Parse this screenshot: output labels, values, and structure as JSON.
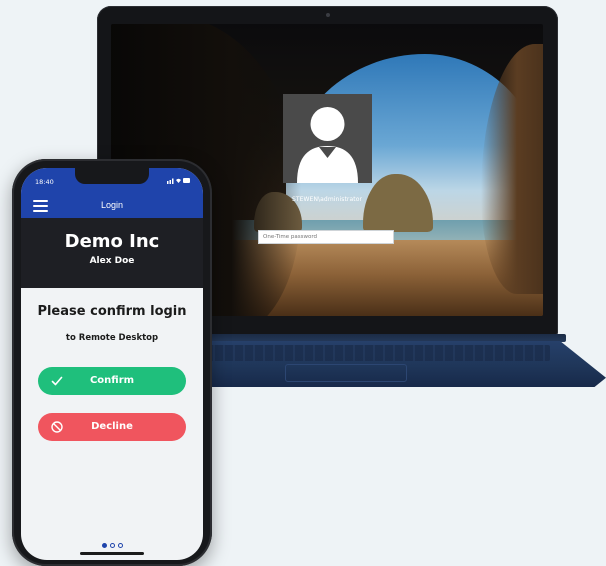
{
  "laptop": {
    "username": "STEWEN\\administrator",
    "otp_placeholder": "One-Time password"
  },
  "phone": {
    "status_time": "18:40",
    "app_title": "Login",
    "company_name": "Demo Inc",
    "user_name": "Alex Doe",
    "confirm_title": "Please confirm login",
    "confirm_subtitle": "to Remote Desktop",
    "confirm_label": "Confirm",
    "decline_label": "Decline",
    "colors": {
      "app_bar": "#1f44ab",
      "confirm": "#1fbf7c",
      "decline": "#f0555e"
    },
    "icons": {
      "menu": "hamburger-menu-icon",
      "confirm": "check-icon",
      "decline": "prohibited-icon"
    }
  }
}
